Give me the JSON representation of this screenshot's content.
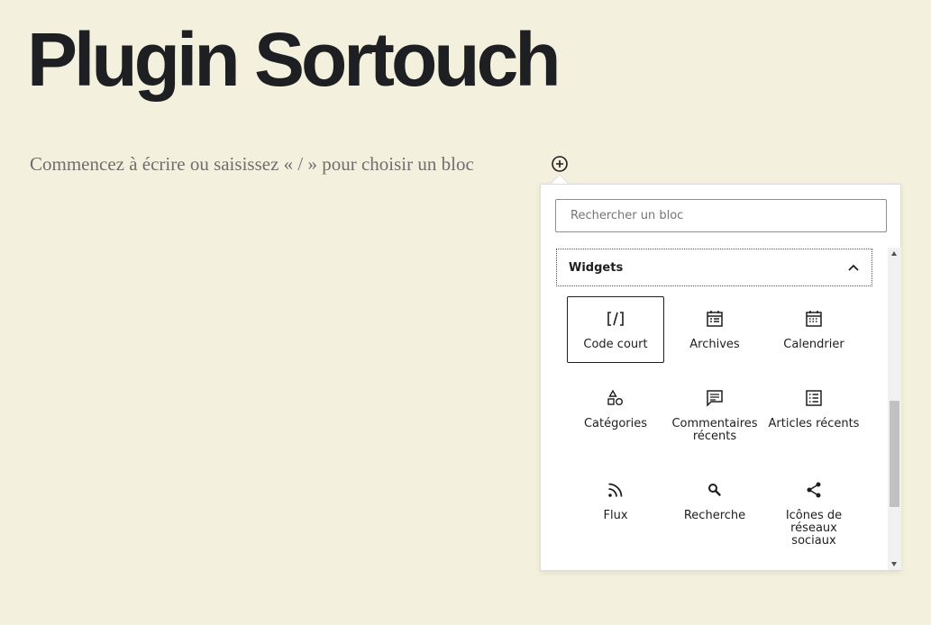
{
  "document": {
    "title": "Plugin Sortouch",
    "placeholder": "Commencez à écrire ou saisissez « / » pour choisir un bloc"
  },
  "inserter": {
    "toggle_icon": "plus-circle-icon",
    "search": {
      "placeholder": "Rechercher un bloc",
      "value": ""
    },
    "panel": {
      "title": "Widgets",
      "expanded": true,
      "toggle_icon": "chevron-up-icon",
      "blocks": [
        {
          "label": "Code court",
          "icon": "shortcode-icon",
          "selected": true
        },
        {
          "label": "Archives",
          "icon": "calendar-archive-icon",
          "selected": false
        },
        {
          "label": "Calendrier",
          "icon": "calendar-icon",
          "selected": false
        },
        {
          "label": "Catégories",
          "icon": "categories-icon",
          "selected": false
        },
        {
          "label": "Commentaires récents",
          "icon": "comment-icon",
          "selected": false
        },
        {
          "label": "Articles récents",
          "icon": "post-list-icon",
          "selected": false
        },
        {
          "label": "Flux",
          "icon": "rss-icon",
          "selected": false
        },
        {
          "label": "Recherche",
          "icon": "search-icon",
          "selected": false
        },
        {
          "label": "Icônes de réseaux sociaux",
          "icon": "share-icon",
          "selected": false
        }
      ]
    }
  },
  "colors": {
    "background": "#f4f0de",
    "text": "#1e1e1e",
    "placeholder": "#6f6f6f"
  }
}
